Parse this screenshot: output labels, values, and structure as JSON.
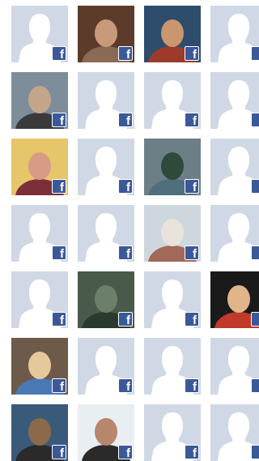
{
  "colors": {
    "silhouette_bg": "#d0d8e6",
    "silhouette_fg": "#ffffff",
    "badge_bg": "#3b5998"
  },
  "badge_letter": "f",
  "rows": [
    [
      {
        "type": "default",
        "icon": "default-profile-icon"
      },
      {
        "type": "photo",
        "icon": "profile-photo-icon",
        "palette": [
          "#5d3b2a",
          "#c79a7a",
          "#8a6a55"
        ]
      },
      {
        "type": "photo",
        "icon": "profile-photo-icon",
        "palette": [
          "#2e4c6b",
          "#c9966f",
          "#9c3a2c"
        ]
      },
      {
        "type": "default",
        "icon": "default-profile-icon"
      }
    ],
    [
      {
        "type": "photo",
        "icon": "profile-photo-icon",
        "palette": [
          "#7d8d9a",
          "#c3a58a",
          "#3a3a3a"
        ]
      },
      {
        "type": "default",
        "icon": "default-profile-icon"
      },
      {
        "type": "default",
        "icon": "default-profile-icon"
      },
      {
        "type": "default",
        "icon": "default-profile-icon"
      }
    ],
    [
      {
        "type": "photo",
        "icon": "profile-photo-icon",
        "palette": [
          "#e7c56a",
          "#d79c86",
          "#7a2f3a"
        ]
      },
      {
        "type": "default",
        "icon": "default-profile-icon"
      },
      {
        "type": "photo",
        "icon": "profile-photo-icon",
        "palette": [
          "#6c7f86",
          "#2d4a3a",
          "#4f6f7d"
        ]
      },
      {
        "type": "default",
        "icon": "default-profile-icon"
      }
    ],
    [
      {
        "type": "default",
        "icon": "default-profile-icon"
      },
      {
        "type": "default",
        "icon": "default-profile-icon"
      },
      {
        "type": "photo",
        "icon": "profile-photo-icon",
        "palette": [
          "#cfd7de",
          "#e8e4dc",
          "#a2685a"
        ]
      },
      {
        "type": "default",
        "icon": "default-profile-icon"
      }
    ],
    [
      {
        "type": "default",
        "icon": "default-profile-icon"
      },
      {
        "type": "photo",
        "icon": "profile-photo-icon",
        "palette": [
          "#4a5a4a",
          "#6b7f6a",
          "#2b3a2f"
        ]
      },
      {
        "type": "default",
        "icon": "default-profile-icon"
      },
      {
        "type": "photo",
        "icon": "profile-photo-icon",
        "palette": [
          "#1a1a1a",
          "#e2b48a",
          "#c0392b"
        ]
      }
    ],
    [
      {
        "type": "photo",
        "icon": "profile-photo-icon",
        "palette": [
          "#6e5a4a",
          "#e6c99a",
          "#4a7ab5"
        ]
      },
      {
        "type": "default",
        "icon": "default-profile-icon"
      },
      {
        "type": "default",
        "icon": "default-profile-icon"
      },
      {
        "type": "default",
        "icon": "default-profile-icon"
      }
    ],
    [
      {
        "type": "photo",
        "icon": "profile-photo-icon",
        "palette": [
          "#3a5a7a",
          "#8a6a4a",
          "#2a2a2a"
        ]
      },
      {
        "type": "photo",
        "icon": "profile-photo-icon",
        "palette": [
          "#e9eef2",
          "#b8866a",
          "#2a2a2a"
        ]
      },
      {
        "type": "default",
        "icon": "default-profile-icon"
      },
      {
        "type": "default",
        "icon": "default-profile-icon"
      }
    ]
  ]
}
